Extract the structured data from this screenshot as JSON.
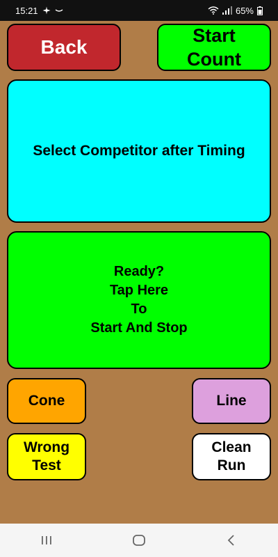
{
  "status_bar": {
    "time": "15:21",
    "battery": "65%",
    "left_icons": [
      "airplane-icon",
      "minus-icon"
    ],
    "right_icons": [
      "wifi-icon",
      "signal-icon",
      "battery-icon"
    ]
  },
  "header": {
    "back_label": "Back",
    "start_count_label": "Start\nCount"
  },
  "competitor_panel": {
    "label": "Select Competitor after Timing"
  },
  "timer_panel": {
    "label": "Ready?\nTap Here\nTo\nStart And Stop"
  },
  "penalties": {
    "cone_label": "Cone",
    "line_label": "Line",
    "wrong_test_label": "Wrong\nTest",
    "clean_run_label": "Clean\nRun"
  },
  "nav_bar": {
    "icons": [
      "recent-apps-icon",
      "home-icon",
      "back-nav-icon"
    ]
  },
  "colors": {
    "background": "#b07d48",
    "back": "#c1272d",
    "start_count": "#00ff00",
    "competitor_panel": "#00ffff",
    "timer_panel": "#00ff00",
    "cone": "#ffa500",
    "line": "#dda0dd",
    "wrong_test": "#ffff00",
    "clean_run": "#ffffff"
  }
}
